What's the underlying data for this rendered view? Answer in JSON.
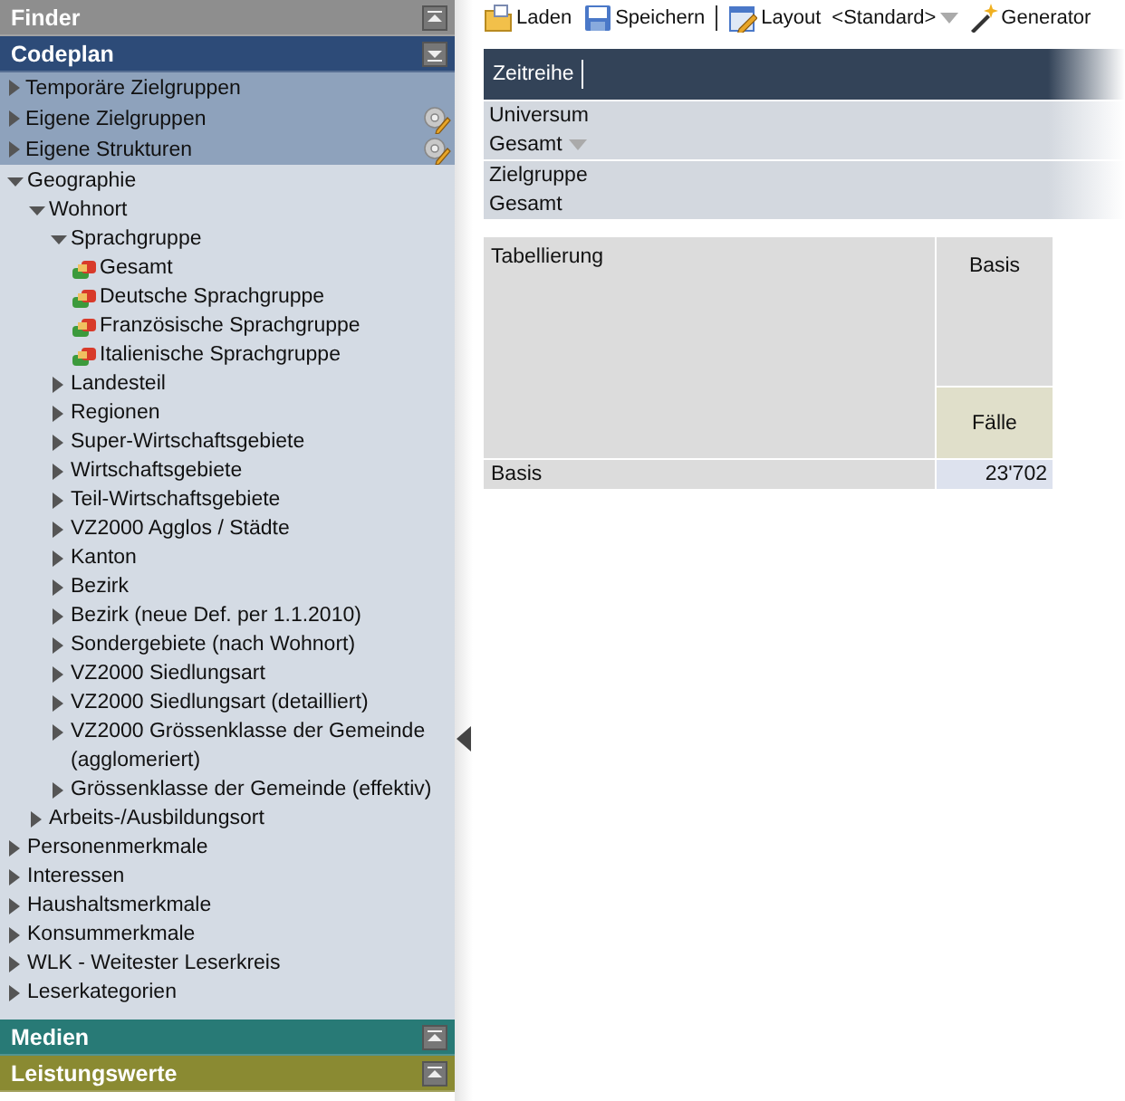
{
  "toolbar": {
    "buttons": [
      {
        "label": "Laden",
        "kind": "open"
      },
      {
        "label": "Speichern",
        "kind": "save"
      },
      {
        "label": "Layout",
        "kind": "layout"
      }
    ],
    "layout_value": "<Standard>",
    "generator": "Generator"
  },
  "sidebar": {
    "sections": [
      {
        "title": "Finder",
        "color": "#8e8e8e",
        "expanded": false
      },
      {
        "title": "Codeplan",
        "color": "#2d4b78",
        "expanded": true,
        "items": [
          {
            "label": "Temporäre Zielgruppen",
            "editable": false
          },
          {
            "label": "Eigene Zielgruppen",
            "editable": true
          },
          {
            "label": "Eigene Strukturen",
            "editable": true
          }
        ],
        "tree": [
          {
            "label": "Geographie",
            "kind": "folder",
            "expanded": true,
            "children": [
              {
                "label": "Wohnort",
                "kind": "folder",
                "expanded": true,
                "children": [
                  {
                    "label": "Sprachgruppe",
                    "kind": "folder",
                    "expanded": true,
                    "children": [
                      {
                        "label": "Gesamt",
                        "kind": "code"
                      },
                      {
                        "label": "Deutsche Sprachgruppe",
                        "kind": "code"
                      },
                      {
                        "label": "Französische Sprachgruppe",
                        "kind": "code"
                      },
                      {
                        "label": "Italienische Sprachgruppe",
                        "kind": "code"
                      }
                    ]
                  },
                  {
                    "label": "Landesteil",
                    "kind": "folder",
                    "expanded": false
                  },
                  {
                    "label": "Regionen",
                    "kind": "folder",
                    "expanded": false
                  },
                  {
                    "label": "Super-Wirtschaftsgebiete",
                    "kind": "folder",
                    "expanded": false
                  },
                  {
                    "label": "Wirtschaftsgebiete",
                    "kind": "folder",
                    "expanded": false
                  },
                  {
                    "label": "Teil-Wirtschaftsgebiete",
                    "kind": "folder",
                    "expanded": false
                  },
                  {
                    "label": "VZ2000 Agglos / Städte",
                    "kind": "folder",
                    "expanded": false
                  },
                  {
                    "label": "Kanton",
                    "kind": "folder",
                    "expanded": false
                  },
                  {
                    "label": "Bezirk",
                    "kind": "folder",
                    "expanded": false
                  },
                  {
                    "label": "Bezirk (neue Def. per 1.1.2010)",
                    "kind": "folder",
                    "expanded": false
                  },
                  {
                    "label": "Sondergebiete (nach Wohnort)",
                    "kind": "folder",
                    "expanded": false
                  },
                  {
                    "label": "VZ2000 Siedlungsart",
                    "kind": "folder",
                    "expanded": false
                  },
                  {
                    "label": "VZ2000 Siedlungsart (detailliert)",
                    "kind": "folder",
                    "expanded": false
                  },
                  {
                    "label": "VZ2000 Grössenklasse der Gemeinde (agglomeriert)",
                    "kind": "folder",
                    "expanded": false
                  },
                  {
                    "label": "Grössenklasse der Gemeinde (effektiv)",
                    "kind": "folder",
                    "expanded": false
                  }
                ]
              },
              {
                "label": "Arbeits-/Ausbildungsort",
                "kind": "folder",
                "expanded": false
              }
            ]
          },
          {
            "label": "Personenmerkmale",
            "kind": "folder",
            "expanded": false
          },
          {
            "label": "Interessen",
            "kind": "folder",
            "expanded": false
          },
          {
            "label": "Haushaltsmerkmale",
            "kind": "folder",
            "expanded": false
          },
          {
            "label": "Konsummerkmale",
            "kind": "folder",
            "expanded": false
          },
          {
            "label": "WLK - Weitester Leserkreis",
            "kind": "folder",
            "expanded": false
          },
          {
            "label": "Leserkategorien",
            "kind": "folder",
            "expanded": false
          }
        ]
      },
      {
        "title": "Medien",
        "color": "#287a76",
        "expanded": false
      },
      {
        "title": "Leistungswerte",
        "color": "#8a8a32",
        "expanded": false
      }
    ]
  },
  "header_bar": {
    "label": "Zeitreihe"
  },
  "filters": [
    {
      "label": "Universum",
      "value": "Gesamt",
      "dropdown": true
    },
    {
      "label": "Zielgruppe",
      "value": "Gesamt",
      "dropdown": false
    }
  ],
  "table": {
    "corner": "Tabellierung",
    "column": "Basis",
    "measure": "Fälle",
    "rows": [
      {
        "label": "Basis",
        "value": "23'702"
      }
    ]
  }
}
